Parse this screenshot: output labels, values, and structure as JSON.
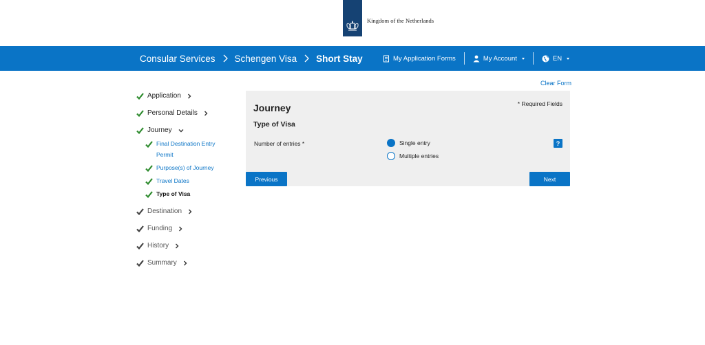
{
  "header": {
    "logo_text": "Kingdom of the Netherlands"
  },
  "nav": {
    "breadcrumbs": [
      "Consular Services",
      "Schengen Visa",
      "Short Stay"
    ],
    "my_application_forms": "My Application Forms",
    "my_account": "My Account",
    "language": "EN"
  },
  "clear_form": "Clear Form",
  "sidebar": {
    "items": [
      {
        "label": "Application"
      },
      {
        "label": "Personal Details"
      },
      {
        "label": "Journey"
      },
      {
        "label": "Destination"
      },
      {
        "label": "Funding"
      },
      {
        "label": "History"
      },
      {
        "label": "Summary"
      }
    ],
    "journey_sub": [
      {
        "label_line1": "Final Destination Entry",
        "label_line2": "Permit"
      },
      {
        "label": "Purpose(s) of Journey"
      },
      {
        "label": "Travel Dates"
      },
      {
        "label": "Type of Visa"
      }
    ]
  },
  "form": {
    "title": "Journey",
    "required_note": "* Required Fields",
    "section": "Type of Visa",
    "field_label": "Number of entries *",
    "options": [
      {
        "label": "Single entry",
        "selected": true
      },
      {
        "label": "Multiple entries",
        "selected": false
      }
    ],
    "help": "?",
    "previous": "Previous",
    "next": "Next"
  },
  "colors": {
    "brand_blue": "#0a74c6",
    "logo_navy": "#154273",
    "check_green": "#2e8b2e",
    "panel_gray": "#efefef"
  }
}
